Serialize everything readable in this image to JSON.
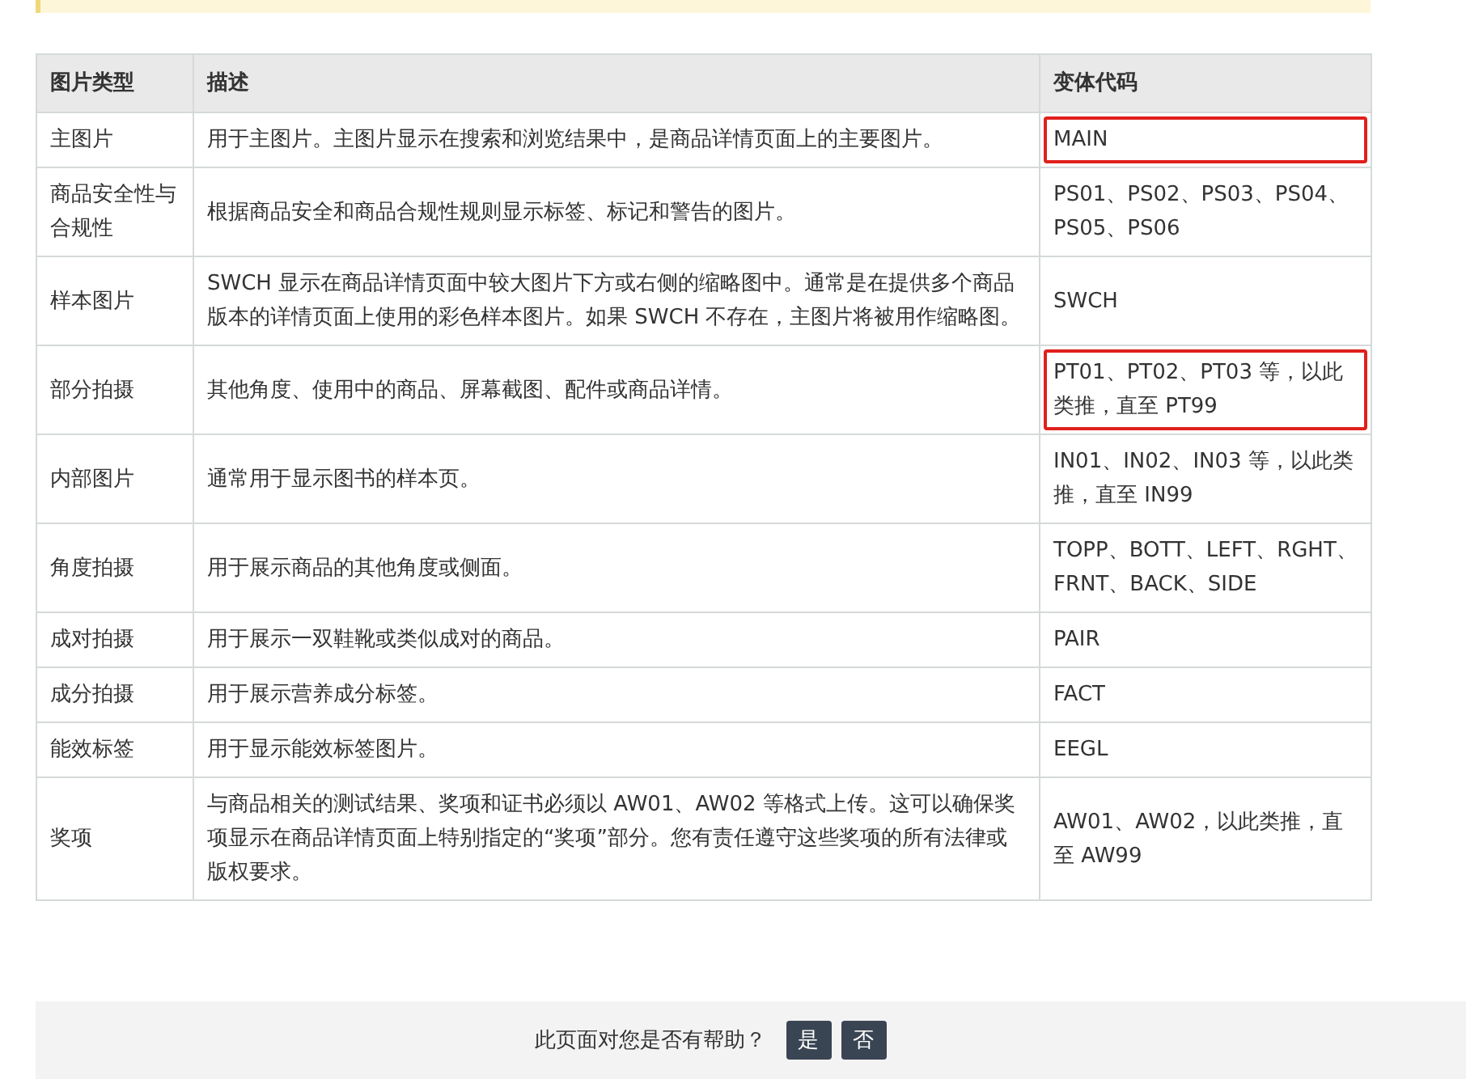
{
  "note_banner": {
    "kind": "note"
  },
  "table": {
    "columns": [
      "图片类型",
      "描述",
      "变体代码"
    ],
    "rows": [
      {
        "type": "主图片",
        "description": "用于主图片。主图片显示在搜索和浏览结果中，是商品详情页面上的主要图片。",
        "code": "MAIN",
        "highlighted": true
      },
      {
        "type": "商品安全性与合规性",
        "description": "根据商品安全和商品合规性规则显示标签、标记和警告的图片。",
        "code": "PS01、PS02、PS03、PS04、PS05、PS06",
        "highlighted": false
      },
      {
        "type": "样本图片",
        "description": "SWCH 显示在商品详情页面中较大图片下方或右侧的缩略图中。通常是在提供多个商品版本的详情页面上使用的彩色样本图片。如果 SWCH 不存在，主图片将被用作缩略图。",
        "code": "SWCH",
        "highlighted": false
      },
      {
        "type": "部分拍摄",
        "description": "其他角度、使用中的商品、屏幕截图、配件或商品详情。",
        "code": "PT01、PT02、PT03 等，以此类推，直至 PT99",
        "highlighted": true
      },
      {
        "type": "内部图片",
        "description": "通常用于显示图书的样本页。",
        "code": "IN01、IN02、IN03 等，以此类推，直至 IN99",
        "highlighted": false
      },
      {
        "type": "角度拍摄",
        "description": "用于展示商品的其他角度或侧面。",
        "code": "TOPP、BOTT、LEFT、RGHT、FRNT、BACK、SIDE",
        "highlighted": false
      },
      {
        "type": "成对拍摄",
        "description": "用于展示一双鞋靴或类似成对的商品。",
        "code": "PAIR",
        "highlighted": false
      },
      {
        "type": "成分拍摄",
        "description": "用于展示营养成分标签。",
        "code": "FACT",
        "highlighted": false
      },
      {
        "type": "能效标签",
        "description": "用于显示能效标签图片。",
        "code": "EEGL",
        "highlighted": false
      },
      {
        "type": "奖项",
        "description": "与商品相关的测试结果、奖项和证书必须以 AW01、AW02 等格式上传。这可以确保奖项显示在商品详情页面上特别指定的“奖项”部分。您有责任遵守这些奖项的所有法律或版权要求。",
        "code": "AW01、AW02，以此类推，直至 AW99",
        "highlighted": false
      }
    ]
  },
  "feedback": {
    "question": "此页面对您是否有帮助？",
    "buttons": [
      "是",
      "否"
    ]
  }
}
